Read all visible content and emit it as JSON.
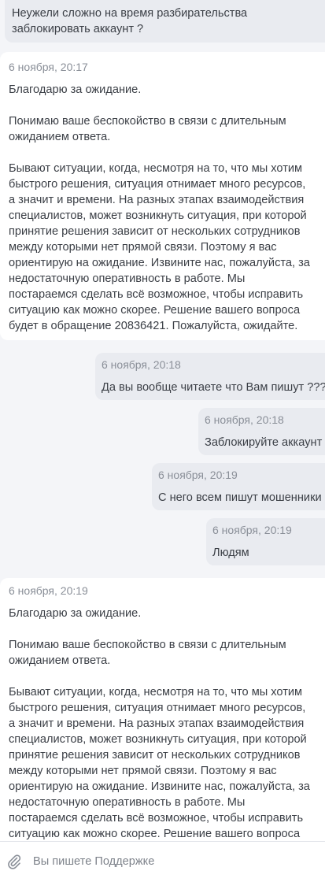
{
  "messages": [
    {
      "direction": "out",
      "time": "",
      "text": "Неужели сложно на время разбирательства\nзаблокировать аккаунт ?"
    },
    {
      "direction": "in",
      "time": "6 ноября, 20:17",
      "text": "Благодарю за ожидание.\n\nПонимаю ваше беспокойство в связи с длительным\nожиданием ответа.\n\nБывают ситуации, когда, несмотря на то, что мы хотим\nбыстрого решения, ситуация отнимает много ресурсов,\nа значит и времени. На разных этапах взаимодействия\nспециалистов, может возникнуть ситуация, при которой\nпринятие решения зависит от нескольких сотрудников\nмежду которыми нет прямой связи. Поэтому я вас\nориентирую на ожидание. Извините нас, пожалуйста, за\nнедостаточную оперативность в работе. Мы\nпостараемся сделать всё возможное, чтобы исправить\nситуацию как можно скорее. Решение вашего вопроса\nбудет в обращение 20836421. Пожалуйста, ожидайте."
    },
    {
      "direction": "out",
      "time": "6 ноября, 20:18",
      "text": "Да вы вообще читаете что Вам пишут ???"
    },
    {
      "direction": "out",
      "time": "6 ноября, 20:18",
      "text": "Заблокируйте аккаунт"
    },
    {
      "direction": "out",
      "time": "6 ноября, 20:19",
      "text": "С него всем пишут мошенники"
    },
    {
      "direction": "out",
      "time": "6 ноября, 20:19",
      "text": "Людям"
    },
    {
      "direction": "in",
      "time": "6 ноября, 20:19",
      "text": "Благодарю за ожидание.\n\nПонимаю ваше беспокойство в связи с длительным\nожиданием ответа.\n\nБывают ситуации, когда, несмотря на то, что мы хотим\nбыстрого решения, ситуация отнимает много ресурсов,\nа значит и времени. На разных этапах взаимодействия\nспециалистов, может возникнуть ситуация, при которой\nпринятие решения зависит от нескольких сотрудников\nмежду которыми нет прямой связи. Поэтому я вас\nориентирую на ожидание. Извините нас, пожалуйста, за\nнедостаточную оперативность в работе. Мы\nпостараемся сделать всё возможное, чтобы исправить\nситуацию как можно скорее. Решение вашего вопроса"
    }
  ],
  "composer": {
    "placeholder": "Вы пишете Поддержке",
    "value": "",
    "attach_icon": "paperclip-icon"
  },
  "colors": {
    "background": "#f4f5f8",
    "incoming_bubble": "#ffffff",
    "outgoing_bubble": "#e9ebf0",
    "text": "#3b3f46",
    "timestamp": "#8a8f98"
  }
}
